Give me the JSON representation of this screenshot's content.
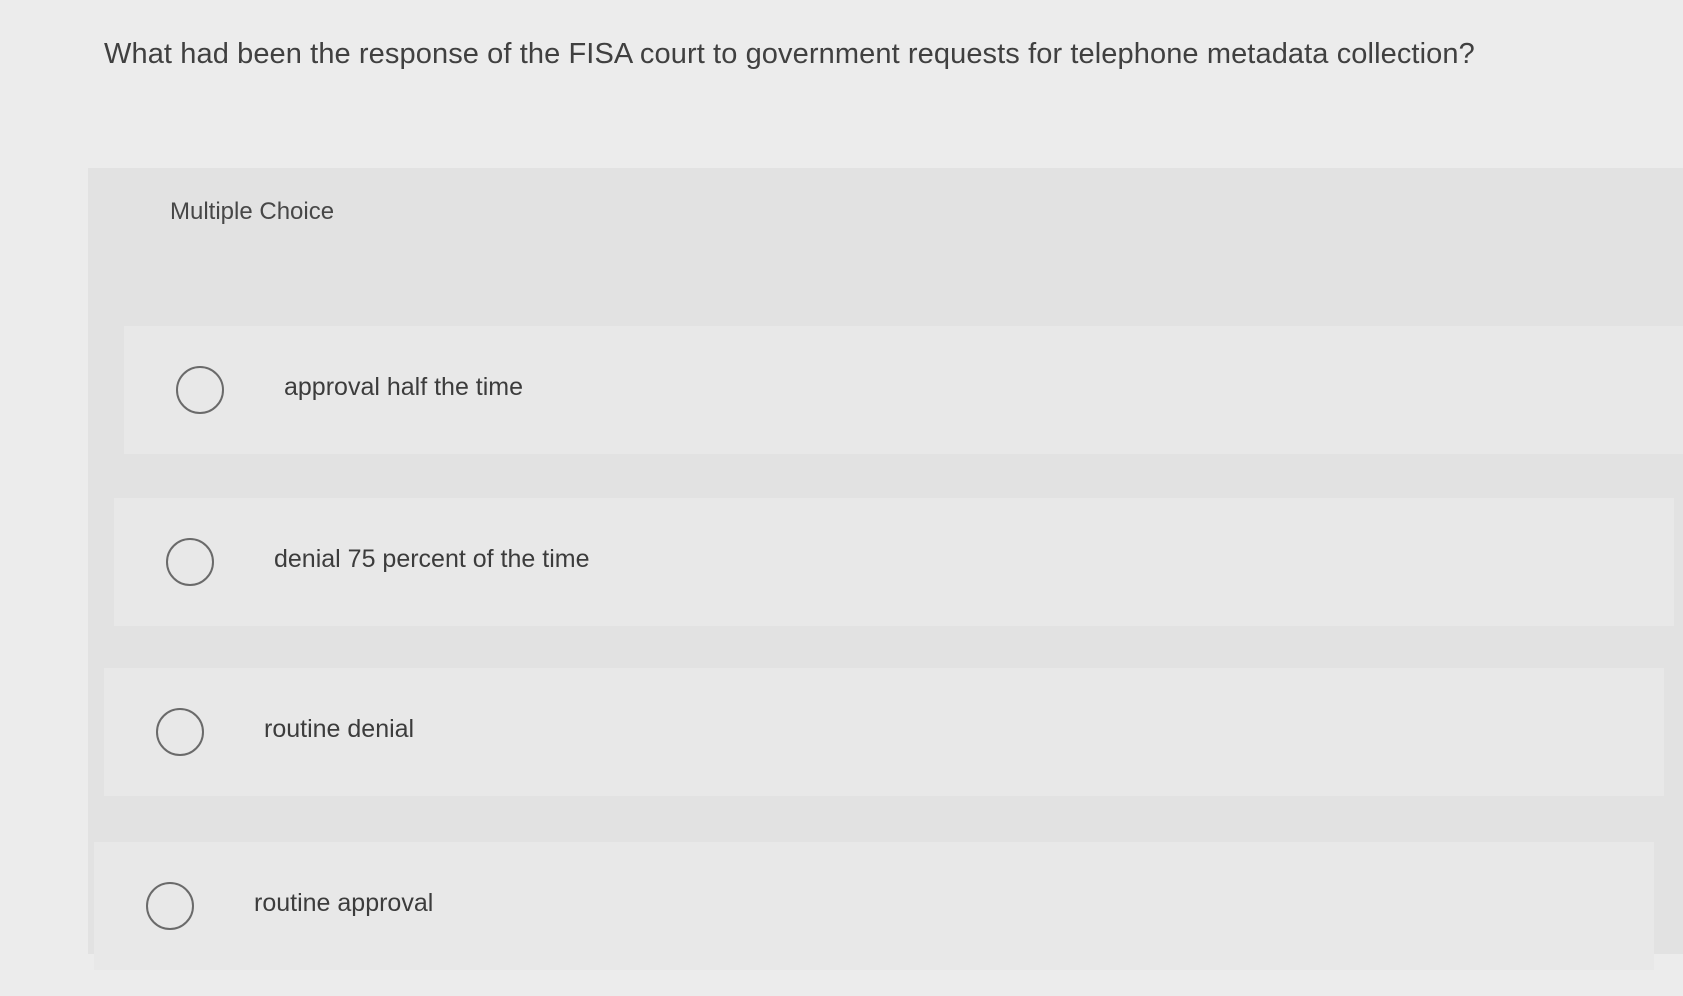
{
  "question": {
    "text": "What had been the response of the FISA court to government requests for telephone metadata collection?"
  },
  "question_type": "Multiple Choice",
  "options": [
    {
      "label": "approval half the time",
      "selected": false
    },
    {
      "label": "denial 75 percent of the time",
      "selected": false
    },
    {
      "label": "routine denial",
      "selected": false
    },
    {
      "label": "routine approval",
      "selected": false
    }
  ],
  "colors": {
    "page_background": "#ececec",
    "panel_background": "#e2e2e2",
    "option_background": "#e8e8e8",
    "radio_border": "#6a6a6a",
    "text": "#3c3c3c"
  },
  "icons": {
    "radio": "radio-unchecked-icon"
  }
}
